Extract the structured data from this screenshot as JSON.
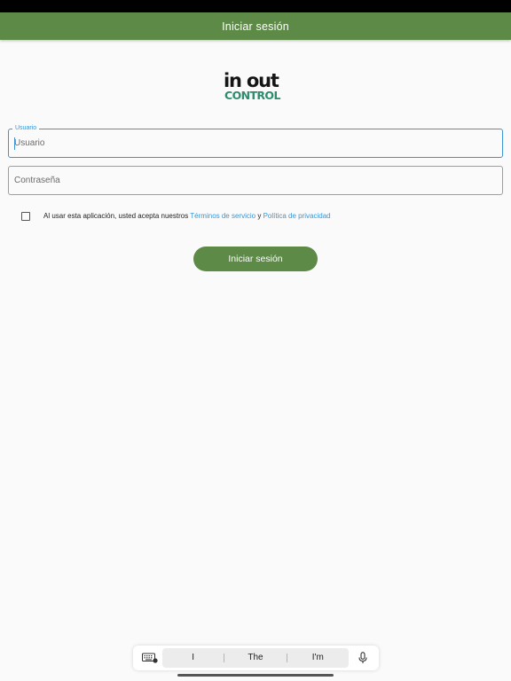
{
  "app_bar": {
    "title": "Iniciar sesión",
    "color": "#5e8a48"
  },
  "logo": {
    "line1": "in out",
    "line2": "CONTROL"
  },
  "form": {
    "username": {
      "label": "Usuario",
      "placeholder": "Usuario",
      "value": ""
    },
    "password": {
      "placeholder": "Contraseña",
      "value": ""
    },
    "consent": {
      "checked": false,
      "prefix": "Al usar esta aplicación, usted acepta nuestros",
      "terms_link": "Términos de servicio",
      "joiner": "y",
      "privacy_link": "Política de privacidad"
    },
    "submit_label": "Iniciar sesión"
  },
  "keyboard_bar": {
    "suggestions": [
      "I",
      "The",
      "I'm"
    ],
    "icons": [
      "keyboard-icon",
      "microphone-icon"
    ]
  },
  "colors": {
    "accent": "#5e8a48",
    "link": "#3b95d2",
    "logo_green": "#2e8b6c"
  }
}
